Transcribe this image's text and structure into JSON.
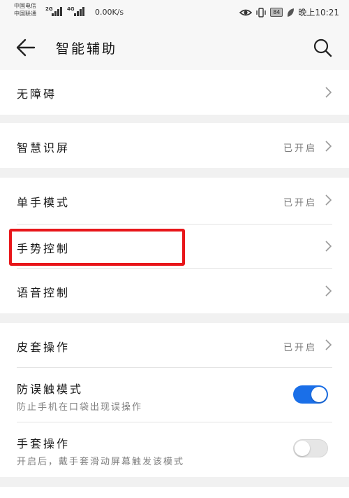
{
  "status_bar": {
    "carrier_1": "中国电信",
    "carrier_2": "中国联通",
    "net_1": "2G",
    "net_2": "4G",
    "speed": "0.00K/s",
    "battery": "84",
    "time": "晚上10:21"
  },
  "app_bar": {
    "title": "智能辅助"
  },
  "sections": {
    "accessibility": {
      "title": "无障碍"
    },
    "smart_screen": {
      "title": "智慧识屏",
      "value": "已开启"
    },
    "one_hand": {
      "title": "单手模式",
      "value": "已开启"
    },
    "gesture": {
      "title": "手势控制"
    },
    "voice": {
      "title": "语音控制"
    },
    "glove_cover": {
      "title": "皮套操作",
      "value": "已开启"
    },
    "pocket_mode": {
      "title": "防误触模式",
      "subtitle": "防止手机在口袋出现误操作",
      "enabled": true
    },
    "glove_mode": {
      "title": "手套操作",
      "subtitle": "开启后，戴手套滑动屏幕触发该模式",
      "enabled": false
    }
  },
  "colors": {
    "toggle_on": "#1a6fe8",
    "highlight": "#e8161a"
  }
}
